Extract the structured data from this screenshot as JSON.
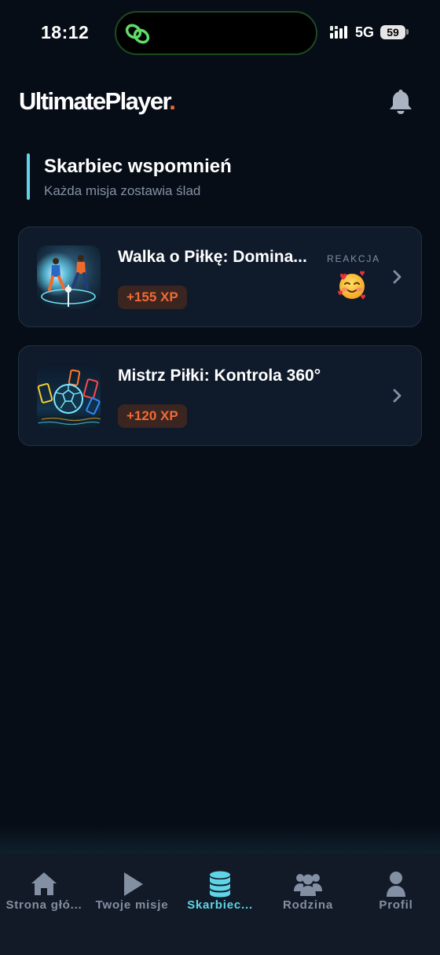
{
  "status_bar": {
    "time": "18:12",
    "network": "5G",
    "battery": "59"
  },
  "header": {
    "logo_text": "UltimatePlayer",
    "logo_dot": ".",
    "logo_dot_color": "#f26a35",
    "bell_icon": "bell-icon"
  },
  "section": {
    "title": "Skarbiec wspomnień",
    "subtitle": "Każda misja zostawia ślad",
    "accent_color": "#5fd4e6"
  },
  "missions": [
    {
      "title": "Walka o Piłkę: Domina...",
      "xp": "+155 XP",
      "reaction_label": "REAKCJA",
      "reaction_emoji": "smiling-face-with-hearts"
    },
    {
      "title": "Mistrz Piłki: Kontrola 360°",
      "xp": "+120 XP"
    }
  ],
  "bottom_nav": {
    "items": [
      {
        "label": "Strona głó...",
        "icon": "home-icon",
        "active": false
      },
      {
        "label": "Twoje misje",
        "icon": "play-icon",
        "active": false
      },
      {
        "label": "Skarbiec...",
        "icon": "database-icon",
        "active": true
      },
      {
        "label": "Rodzina",
        "icon": "users-icon",
        "active": false
      },
      {
        "label": "Profil",
        "icon": "user-icon",
        "active": false
      }
    ],
    "active_color": "#5fd4e6",
    "inactive_color": "#8390a3"
  }
}
